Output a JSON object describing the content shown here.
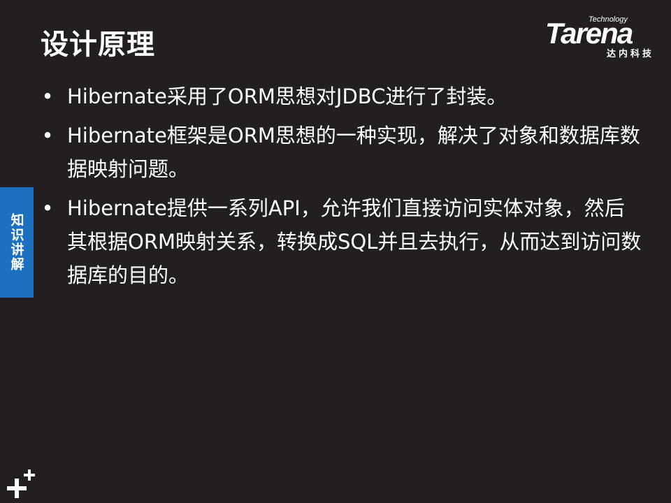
{
  "slide": {
    "title": "设计原理",
    "logo": {
      "small_text": "Technology",
      "brand": "Tarena",
      "chinese": "达内科技"
    },
    "side_tab": "知识讲解",
    "bullet_glyph": "•",
    "bullets": [
      "Hibernate采用了ORM思想对JDBC进行了封装。",
      "Hibernate框架是ORM思想的一种实现，解决了对象和数据库数据映射问题。",
      "Hibernate提供一系列API，允许我们直接访问实体对象，然后其根据ORM映射关系，转换成SQL并且去执行，从而达到访问数据库的目的。"
    ],
    "colors": {
      "background": "#231f20",
      "side_tab": "#1d6fbf",
      "text": "#ffffff"
    },
    "corner_icon": "plus-icon"
  }
}
